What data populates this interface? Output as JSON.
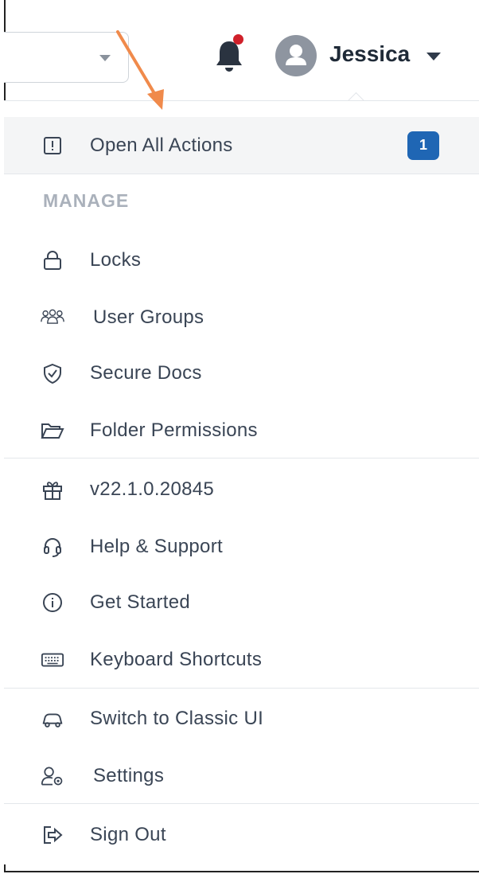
{
  "header": {
    "username": "Jessica",
    "notification_dot_color": "#d0202a",
    "icons": [
      "select-caret-icon",
      "bell-icon",
      "avatar-user-icon",
      "caret-down-icon"
    ]
  },
  "menu": {
    "open_all_actions": {
      "label": "Open All Actions",
      "badge": "1",
      "icon": "alert-square-icon",
      "badge_color": "#1f66b4"
    },
    "manage_heading": "MANAGE",
    "manage_items": [
      {
        "label": "Locks",
        "icon": "lock-icon"
      },
      {
        "label": "User Groups",
        "icon": "users-icon"
      },
      {
        "label": "Secure Docs",
        "icon": "shield-check-icon"
      },
      {
        "label": "Folder Permissions",
        "icon": "folder-open-icon"
      }
    ],
    "info_items": [
      {
        "label": "v22.1.0.20845",
        "icon": "gift-icon"
      },
      {
        "label": "Help & Support",
        "icon": "headset-icon"
      },
      {
        "label": "Get Started",
        "icon": "info-circle-icon"
      },
      {
        "label": "Keyboard Shortcuts",
        "icon": "keyboard-icon"
      }
    ],
    "account_items": [
      {
        "label": "Switch to Classic UI",
        "icon": "classic-car-icon"
      },
      {
        "label": "Settings",
        "icon": "user-settings-icon"
      }
    ],
    "sign_out": {
      "label": "Sign Out",
      "icon": "sign-out-icon"
    }
  },
  "annotation": {
    "arrow_color": "#f08a4b"
  }
}
